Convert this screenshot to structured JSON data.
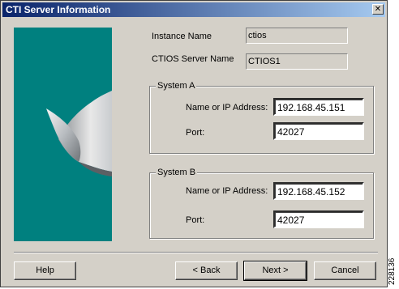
{
  "window": {
    "title": "CTI Server Information",
    "close_glyph": "✕"
  },
  "fields": {
    "instance_name_label": "Instance Name",
    "instance_name_value": "ctios",
    "server_name_label": "CTIOS Server Name",
    "server_name_value": "CTIOS1"
  },
  "system_a": {
    "title": "System A",
    "name_label": "Name or IP Address:",
    "name_value": "192.168.45.151",
    "port_label": "Port:",
    "port_value": "42027"
  },
  "system_b": {
    "title": "System B",
    "name_label": "Name or IP Address:",
    "name_value": "192.168.45.152",
    "port_label": "Port:",
    "port_value": "42027"
  },
  "buttons": {
    "help": "Help",
    "back": "< Back",
    "next": "Next >",
    "cancel": "Cancel"
  },
  "side_code": "228136",
  "colors": {
    "banner": "#00807f",
    "titlebar_start": "#0a246a",
    "dialog_face": "#d4d0c8"
  }
}
